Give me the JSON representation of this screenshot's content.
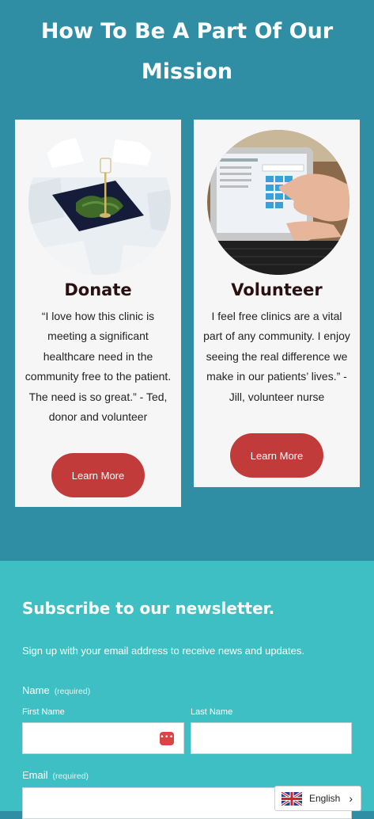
{
  "mission": {
    "title_line1": "How To Be A Part Of Our",
    "title_line2": "Mission",
    "cards": [
      {
        "title": "Donate",
        "quote": "“I love how this clinic is meeting a significant healthcare need in the community free to the patient. The need is so great.”  - Ted, donor and volunteer",
        "button": "Learn More"
      },
      {
        "title": "Volunteer",
        "quote": "I feel free clinics are a vital part of any community. I enjoy seeing the real difference we make in our patients’ lives.” - Jill, volunteer nurse",
        "button": "Learn More"
      }
    ]
  },
  "newsletter": {
    "title": "Subscribe to our newsletter.",
    "description": "Sign up with your email address to receive news and updates.",
    "name_label": "Name",
    "name_required": "(required)",
    "first_name_label": "First Name",
    "last_name_label": "Last Name",
    "email_label": "Email",
    "email_required": "(required)",
    "password_manager_icon": "•••"
  },
  "language": {
    "label": "English",
    "flag_icon": "uk-flag-icon"
  },
  "colors": {
    "mission_bg": "#2f8ea3",
    "newsletter_bg": "#3ebfc3",
    "button": "#c23b3b"
  }
}
